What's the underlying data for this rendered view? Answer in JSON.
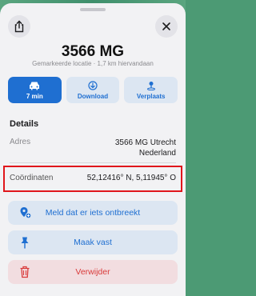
{
  "place": {
    "title": "3566 MG",
    "subtitle": "Gemarkeerde locatie · 1,7 km hiervandaan"
  },
  "actions": [
    {
      "label": "7 min",
      "icon": "car-icon"
    },
    {
      "label": "Download",
      "icon": "download-icon"
    },
    {
      "label": "Verplaats",
      "icon": "move-pin-icon"
    }
  ],
  "details": {
    "section_title": "Details",
    "address_label": "Adres",
    "address_line1": "3566 MG Utrecht",
    "address_line2": "Nederland",
    "coords_label": "Coördinaten",
    "coords_value": "52,12416° N, 5,11945° O"
  },
  "buttons": {
    "report": "Meld dat er iets ontbreekt",
    "pin": "Maak vast",
    "delete": "Verwijder"
  },
  "colors": {
    "accent": "#1f6fd1",
    "danger": "#d93a3a",
    "highlight": "#e0161b"
  }
}
